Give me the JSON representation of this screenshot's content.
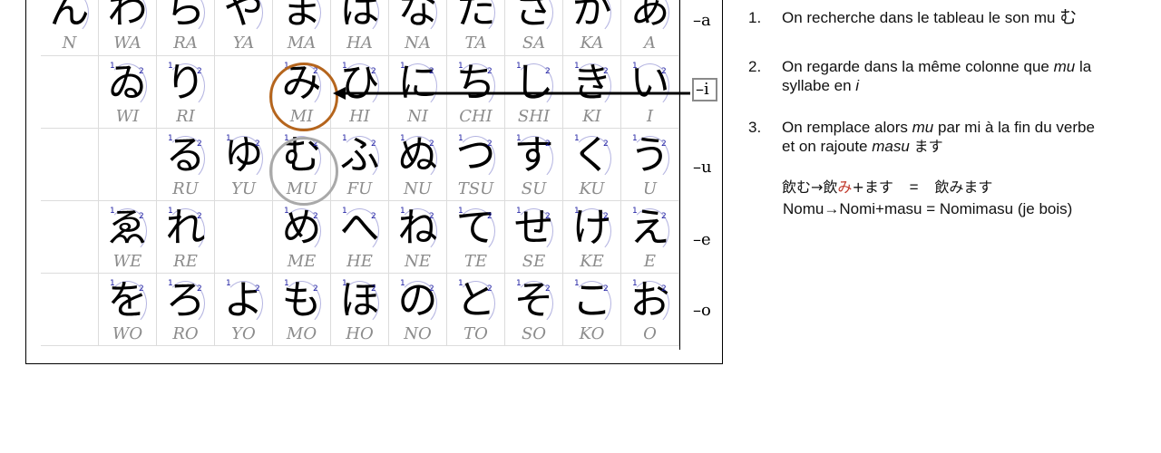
{
  "columns": [
    {
      "kana": [
        "ん",
        "",
        "",
        "",
        ""
      ],
      "roma": [
        "N",
        "",
        "",
        "",
        ""
      ]
    },
    {
      "kana": [
        "わ",
        "ゐ",
        "",
        "ゑ",
        "を"
      ],
      "roma": [
        "WA",
        "WI",
        "",
        "WE",
        "WO"
      ]
    },
    {
      "kana": [
        "ら",
        "り",
        "る",
        "れ",
        "ろ"
      ],
      "roma": [
        "RA",
        "RI",
        "RU",
        "RE",
        "RO"
      ]
    },
    {
      "kana": [
        "や",
        "",
        "ゆ",
        "",
        "よ"
      ],
      "roma": [
        "YA",
        "",
        "YU",
        "",
        "YO"
      ]
    },
    {
      "kana": [
        "ま",
        "み",
        "む",
        "め",
        "も"
      ],
      "roma": [
        "MA",
        "MI",
        "MU",
        "ME",
        "MO"
      ]
    },
    {
      "kana": [
        "は",
        "ひ",
        "ふ",
        "へ",
        "ほ"
      ],
      "roma": [
        "HA",
        "HI",
        "FU",
        "HE",
        "HO"
      ]
    },
    {
      "kana": [
        "な",
        "に",
        "ぬ",
        "ね",
        "の"
      ],
      "roma": [
        "NA",
        "NI",
        "NU",
        "NE",
        "NO"
      ]
    },
    {
      "kana": [
        "た",
        "ち",
        "つ",
        "て",
        "と"
      ],
      "roma": [
        "TA",
        "CHI",
        "TSU",
        "TE",
        "TO"
      ]
    },
    {
      "kana": [
        "さ",
        "し",
        "す",
        "せ",
        "そ"
      ],
      "roma": [
        "SA",
        "SHI",
        "SU",
        "SE",
        "SO"
      ]
    },
    {
      "kana": [
        "か",
        "き",
        "く",
        "け",
        "こ"
      ],
      "roma": [
        "KA",
        "KI",
        "KU",
        "KE",
        "KO"
      ]
    },
    {
      "kana": [
        "あ",
        "い",
        "う",
        "え",
        "お"
      ],
      "roma": [
        "A",
        "I",
        "U",
        "E",
        "O"
      ]
    }
  ],
  "stroke_numbers": [
    "1",
    "2",
    "3",
    "4"
  ],
  "row_labels": [
    "–a",
    "–i",
    "–u",
    "–e",
    "–o"
  ],
  "highlight": {
    "target": "MI",
    "source": "MU",
    "target_color": "#b5651d",
    "source_color": "#a9a9a9",
    "label_box_color": "#8a8a8a"
  },
  "steps": [
    {
      "number": "1.",
      "line1_text": "On recherche dans le tableau le son mu",
      "line1_kana": "む"
    },
    {
      "number": "2.",
      "line1_a": "On regarde dans la même colonne que",
      "line1_em": "mu",
      "line1_b": "la",
      "line2_a": "syllabe en",
      "line2_em": "i"
    },
    {
      "number": "3.",
      "line1_a": "On remplace alors",
      "line1_em": "mu",
      "line1_b": "par mi à la fin du verbe",
      "line2_a": "et on rajoute",
      "line2_em": "masu",
      "line2_kana": "ます"
    }
  ],
  "example": {
    "jp_a": "飲む→飲",
    "jp_red": "み",
    "jp_b": "+ます",
    "jp_eq": "=",
    "jp_result": "飲みます",
    "romaji": "Nomu→Nomi+masu = Nomimasu (je bois)"
  }
}
